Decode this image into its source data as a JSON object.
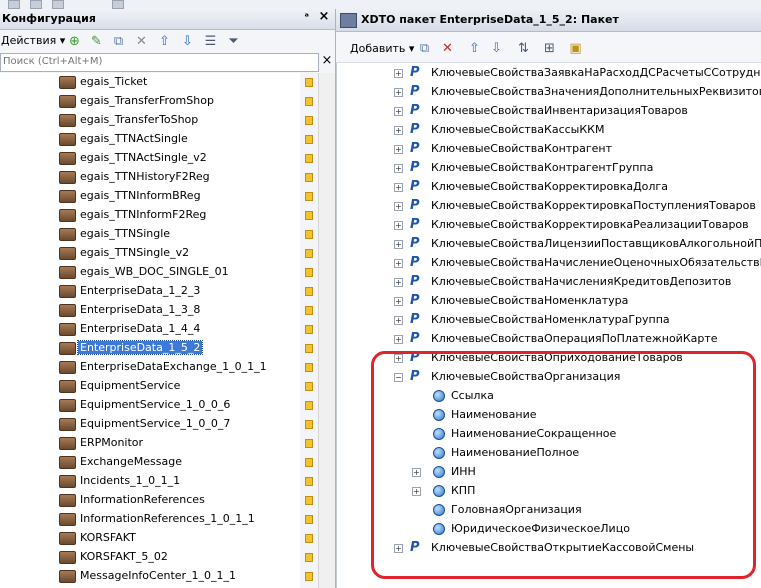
{
  "left_panel": {
    "title": "Конфигурация",
    "pin": "ᵃ",
    "close": "×",
    "actions_label": "Действия ▾",
    "search_placeholder": "Поиск (Ctrl+Alt+M)",
    "items": [
      "egais_Ticket",
      "egais_TransferFromShop",
      "egais_TransferToShop",
      "egais_TTNActSingle",
      "egais_TTNActSingle_v2",
      "egais_TTNHistoryF2Reg",
      "egais_TTNInformBReg",
      "egais_TTNInformF2Reg",
      "egais_TTNSingle",
      "egais_TTNSingle_v2",
      "egais_WB_DOC_SINGLE_01",
      "EnterpriseData_1_2_3",
      "EnterpriseData_1_3_8",
      "EnterpriseData_1_4_4",
      "EnterpriseData_1_5_2",
      "EnterpriseDataExchange_1_0_1_1",
      "EquipmentService",
      "EquipmentService_1_0_0_6",
      "EquipmentService_1_0_0_7",
      "ERPMonitor",
      "ExchangeMessage",
      "Incidents_1_0_1_1",
      "InformationReferences",
      "InformationReferences_1_0_1_1",
      "KORSFAKT",
      "KORSFAKT_5_02",
      "MessageInfoCenter_1_0_1_1"
    ],
    "selected_index": 14
  },
  "right_panel": {
    "title": "XDTO пакет EnterpriseData_1_5_2: Пакет",
    "add_label": "Добавить ▾",
    "tree": [
      {
        "type": "P",
        "text": "КлючевыеСвойстваЗаявкаНаРасходДСРасчетыССотрудниками",
        "level": 0,
        "exp": "+"
      },
      {
        "type": "P",
        "text": "КлючевыеСвойстваЗначенияДополнительныхРеквизитов",
        "level": 0,
        "exp": "+"
      },
      {
        "type": "P",
        "text": "КлючевыеСвойстваИнвентаризацияТоваров",
        "level": 0,
        "exp": "+"
      },
      {
        "type": "P",
        "text": "КлючевыеСвойстваКассыККМ",
        "level": 0,
        "exp": "+"
      },
      {
        "type": "P",
        "text": "КлючевыеСвойстваКонтрагент",
        "level": 0,
        "exp": "+"
      },
      {
        "type": "P",
        "text": "КлючевыеСвойстваКонтрагентГруппа",
        "level": 0,
        "exp": "+"
      },
      {
        "type": "P",
        "text": "КлючевыеСвойстваКорректировкаДолга",
        "level": 0,
        "exp": "+"
      },
      {
        "type": "P",
        "text": "КлючевыеСвойстваКорректировкаПоступленияТоваров",
        "level": 0,
        "exp": "+"
      },
      {
        "type": "P",
        "text": "КлючевыеСвойстваКорректировкаРеализацииТоваров",
        "level": 0,
        "exp": "+"
      },
      {
        "type": "P",
        "text": "КлючевыеСвойстваЛицензииПоставщиковАлкогольнойПродукции",
        "level": 0,
        "exp": "+"
      },
      {
        "type": "P",
        "text": "КлючевыеСвойстваНачислениеОценочныхОбязательствПоОтпускам",
        "level": 0,
        "exp": "+"
      },
      {
        "type": "P",
        "text": "КлючевыеСвойстваНачисленияКредитовДепозитов",
        "level": 0,
        "exp": "+"
      },
      {
        "type": "P",
        "text": "КлючевыеСвойстваНоменклатура",
        "level": 0,
        "exp": "+"
      },
      {
        "type": "P",
        "text": "КлючевыеСвойстваНоменклатураГруппа",
        "level": 0,
        "exp": "+"
      },
      {
        "type": "P",
        "text": "КлючевыеСвойстваОперацияПоПлатежнойКарте",
        "level": 0,
        "exp": "+"
      },
      {
        "type": "P",
        "text": "КлючевыеСвойстваОприходованиеТоваров",
        "level": 0,
        "exp": "+"
      },
      {
        "type": "P",
        "text": "КлючевыеСвойстваОрганизация",
        "level": 0,
        "exp": "−"
      },
      {
        "type": "C",
        "text": "Ссылка",
        "level": 1,
        "exp": ""
      },
      {
        "type": "C",
        "text": "Наименование",
        "level": 1,
        "exp": ""
      },
      {
        "type": "C",
        "text": "НаименованиеСокращенное",
        "level": 1,
        "exp": ""
      },
      {
        "type": "C",
        "text": "НаименованиеПолное",
        "level": 1,
        "exp": ""
      },
      {
        "type": "C",
        "text": "ИНН",
        "level": 1,
        "exp": "+"
      },
      {
        "type": "C",
        "text": "КПП",
        "level": 1,
        "exp": "+"
      },
      {
        "type": "C",
        "text": "ГоловнаяОрганизация",
        "level": 1,
        "exp": ""
      },
      {
        "type": "C",
        "text": "ЮридическоеФизическоеЛицо",
        "level": 1,
        "exp": ""
      },
      {
        "type": "P",
        "text": "КлючевыеСвойстваОткрытиеКассовойСмены",
        "level": 0,
        "exp": "+"
      }
    ]
  },
  "colors": {
    "highlight_box": "#e0242b",
    "selection": "#3d7ad8"
  }
}
